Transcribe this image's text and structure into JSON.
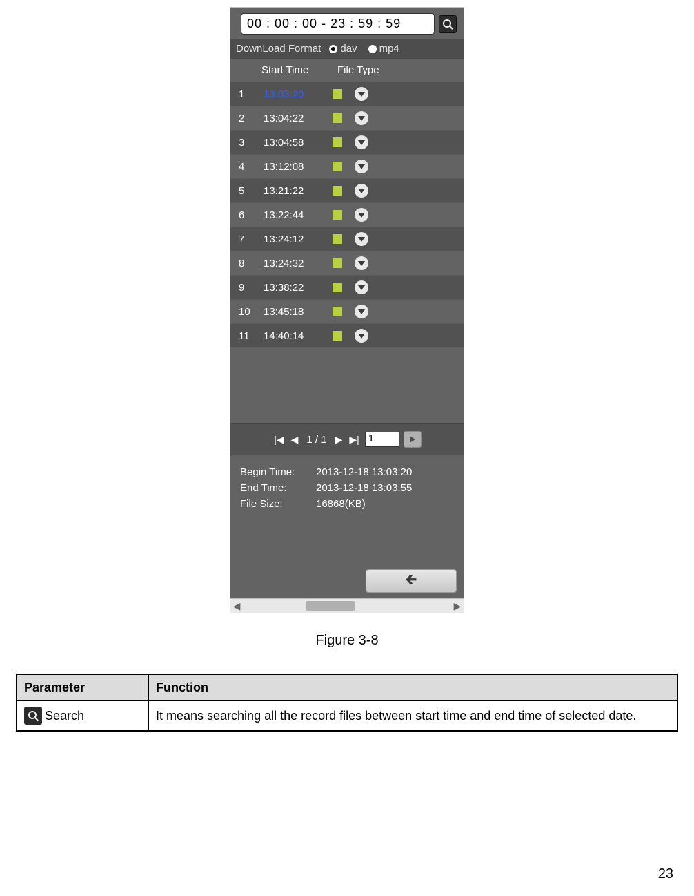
{
  "widget": {
    "time_text": "00 : 00 : 00 - 23 : 59 : 59",
    "format_label": "DownLoad Format",
    "option_dav": "dav",
    "option_mp4": "mp4",
    "header_start": "Start Time",
    "header_file": "File Type",
    "rows": [
      {
        "idx": "1",
        "time": "13:03:20",
        "selected": true
      },
      {
        "idx": "2",
        "time": "13:04:22",
        "selected": false
      },
      {
        "idx": "3",
        "time": "13:04:58",
        "selected": false
      },
      {
        "idx": "4",
        "time": "13:12:08",
        "selected": false
      },
      {
        "idx": "5",
        "time": "13:21:22",
        "selected": false
      },
      {
        "idx": "6",
        "time": "13:22:44",
        "selected": false
      },
      {
        "idx": "7",
        "time": "13:24:12",
        "selected": false
      },
      {
        "idx": "8",
        "time": "13:24:32",
        "selected": false
      },
      {
        "idx": "9",
        "time": "13:38:22",
        "selected": false
      },
      {
        "idx": "10",
        "time": "13:45:18",
        "selected": false
      },
      {
        "idx": "11",
        "time": "14:40:14",
        "selected": false
      }
    ],
    "pager_text": "1 / 1",
    "pager_input": "1",
    "info": {
      "begin_label": "Begin Time:",
      "begin_value": "2013-12-18 13:03:20",
      "end_label": "End Time:",
      "end_value": "2013-12-18 13:03:55",
      "size_label": "File Size:",
      "size_value": "16868(KB)"
    }
  },
  "caption": "Figure 3-8",
  "table": {
    "col_param": "Parameter",
    "col_func": "Function",
    "row_label": "Search",
    "row_desc": "It means searching all the record files between start time and end time of selected date."
  },
  "page_number": "23"
}
